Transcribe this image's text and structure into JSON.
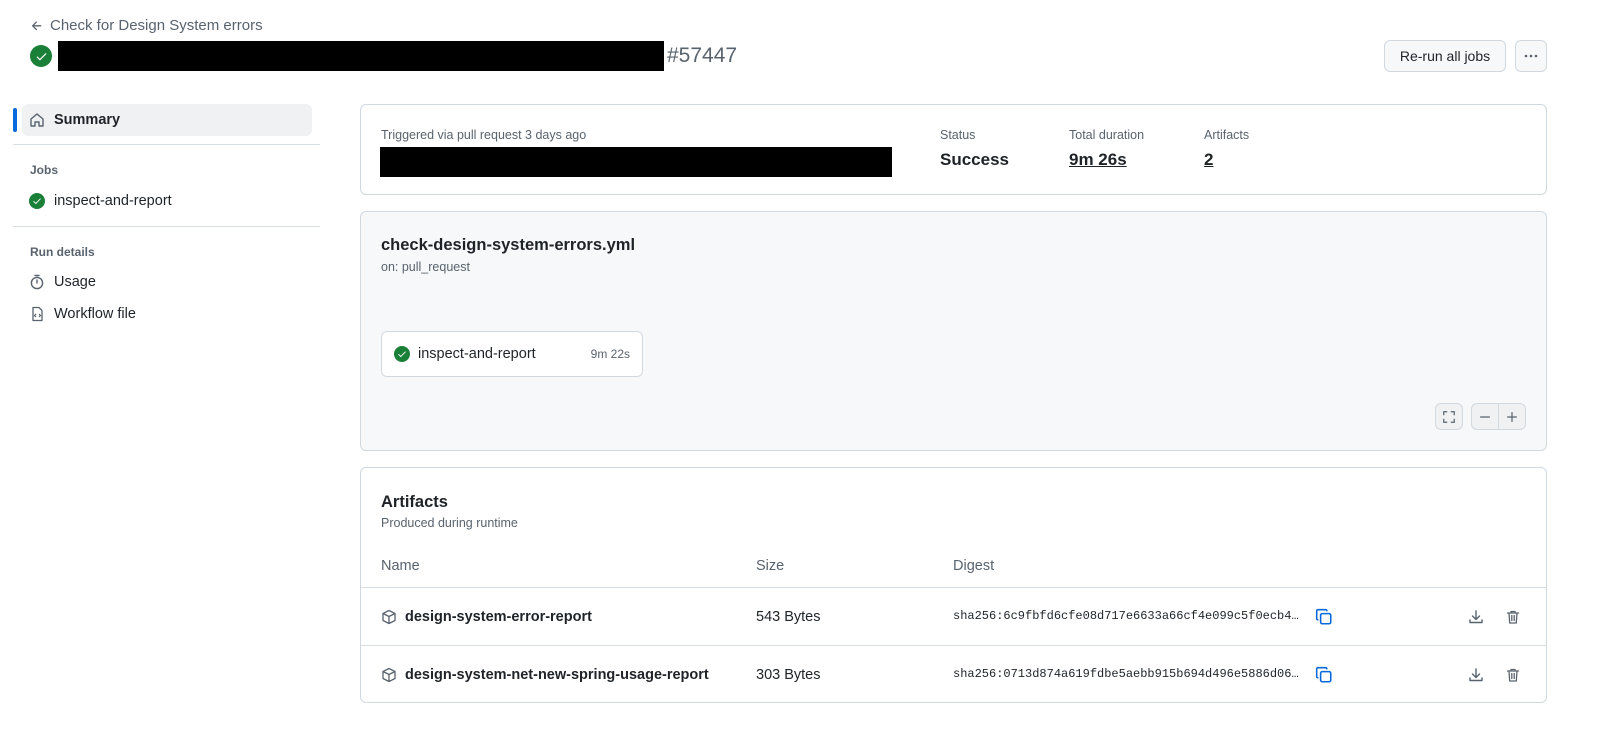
{
  "header": {
    "back_link": "Check for Design System errors",
    "run_number": "#57447",
    "rerun_label": "Re-run all jobs",
    "more_icon": "kebab-horizontal-icon"
  },
  "sidebar": {
    "summary_label": "Summary",
    "jobs_heading": "Jobs",
    "jobs": [
      {
        "label": "inspect-and-report",
        "status": "success"
      }
    ],
    "run_details_heading": "Run details",
    "usage_label": "Usage",
    "workflow_file_label": "Workflow file"
  },
  "summary": {
    "trigger_text": "Triggered via pull request 3 days ago",
    "status_label": "Status",
    "status_value": "Success",
    "duration_label": "Total duration",
    "duration_value": "9m 26s",
    "artifacts_label": "Artifacts",
    "artifacts_value": "2"
  },
  "workflow": {
    "file_name": "check-design-system-errors.yml",
    "trigger": "on: pull_request",
    "job": {
      "name": "inspect-and-report",
      "duration": "9m 22s"
    }
  },
  "artifacts": {
    "title": "Artifacts",
    "subtitle": "Produced during runtime",
    "columns": {
      "name": "Name",
      "size": "Size",
      "digest": "Digest"
    },
    "rows": [
      {
        "name": "design-system-error-report",
        "size": "543 Bytes",
        "digest": "sha256:6c9fbfd6cfe08d717e6633a66cf4e099c5f0ecb4…"
      },
      {
        "name": "design-system-net-new-spring-usage-report",
        "size": "303 Bytes",
        "digest": "sha256:0713d874a619fdbe5aebb915b694d496e5886d06…"
      }
    ]
  },
  "colors": {
    "success": "#1a7f37",
    "accent": "#0969da",
    "muted_text": "#59636e",
    "border": "#d1d9e0"
  }
}
